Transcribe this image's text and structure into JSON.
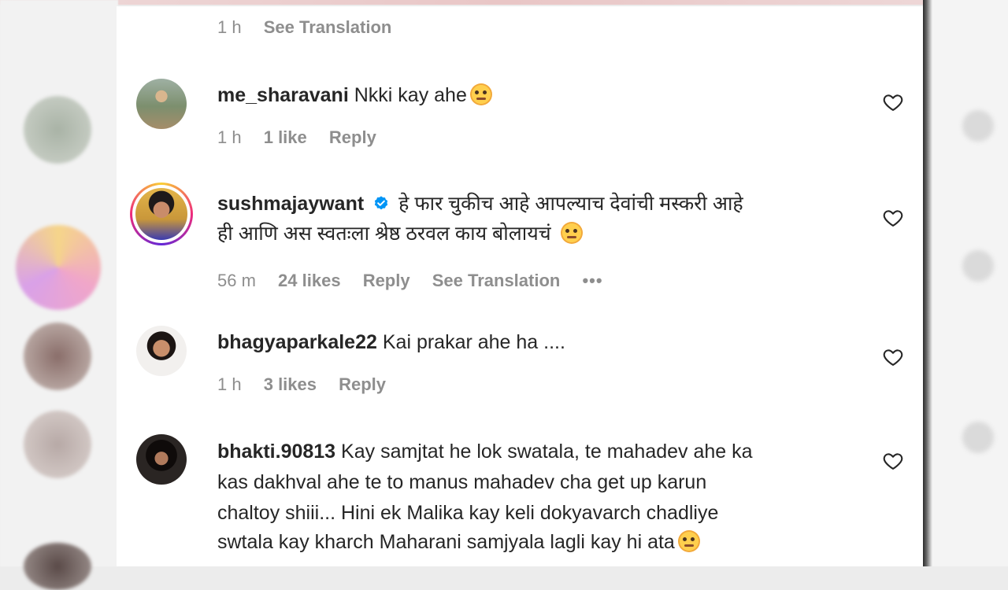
{
  "comments": [
    {
      "time": "1 h",
      "see_translation": "See Translation"
    },
    {
      "username": "me_sharavani",
      "text": "Nkki kay ahe",
      "time": "1 h",
      "likes": "1 like",
      "reply": "Reply"
    },
    {
      "username": "sushmajaywant",
      "verified": true,
      "text_line1": "हे फार चुकीच आहे आपल्याच देवांची मस्करी आहे",
      "text_line2": "ही आणि अस स्वतःला श्रेष्ठ ठरवल काय बोलायचं",
      "time": "56 m",
      "likes": "24 likes",
      "reply": "Reply",
      "see_translation": "See Translation",
      "more": "•••"
    },
    {
      "username": "bhagyaparkale22",
      "text": "Kai prakar ahe ha ....",
      "time": "1 h",
      "likes": "3 likes",
      "reply": "Reply"
    },
    {
      "username": "bhakti.90813",
      "text_line1": "Kay samjtat he lok swatala, te mahadev ahe ka",
      "text_line2": "kas dakhval ahe te to manus mahadev cha get up karun",
      "text_line3": "chaltoy shiii... Hini ek Malika kay keli dokyavarch chadliye",
      "text_line4": "swtala kay kharch Maharani samjyala lagli kay hi ata"
    }
  ],
  "icons": {
    "like": "heart-outline-icon",
    "verified": "verified-badge-icon"
  },
  "colors": {
    "text": "#262626",
    "meta": "#8e8e8e",
    "verified": "#0095f6"
  }
}
